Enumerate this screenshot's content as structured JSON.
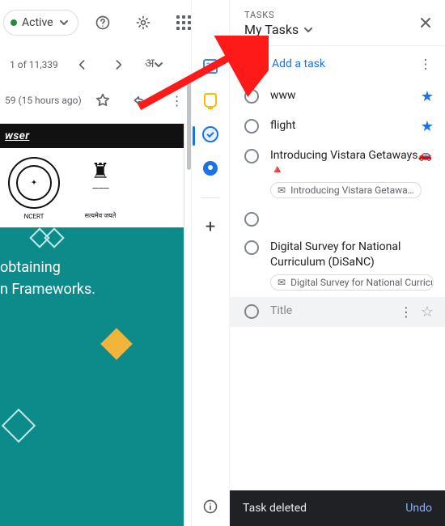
{
  "gmail": {
    "status_chip": "Active",
    "pagination": "1 of 11,339",
    "lang_label": "अ",
    "timestamp_suffix": "59 (15 hours ago)",
    "browser_bar": "wser",
    "stamp1_caption": "NCERT",
    "stamp2_caption": "सत्यमेव जयते",
    "teal_line1": "obtaining",
    "teal_line2": "n Frameworks."
  },
  "rail": {
    "items": [
      "calendar",
      "keep",
      "tasks",
      "contacts",
      "add"
    ]
  },
  "tasks_panel": {
    "label": "TASKS",
    "list_name": "My Tasks",
    "add_label": "Add a task",
    "tasks": [
      {
        "title": "www",
        "starred": true
      },
      {
        "title": "flight",
        "starred": true
      },
      {
        "title": "Introducing Vistara Getaways🚗🔺",
        "mail": "Introducing Vistara Getawa…"
      },
      {
        "title": ""
      },
      {
        "title": "Digital Survey for National Curriculum (DiSaNC)",
        "mail": "Digital Survey for National Curricu…"
      },
      {
        "title": "Title",
        "placeholder": true,
        "selected": true,
        "actions": true
      }
    ]
  },
  "toast": {
    "message": "Task deleted",
    "action": "Undo"
  }
}
